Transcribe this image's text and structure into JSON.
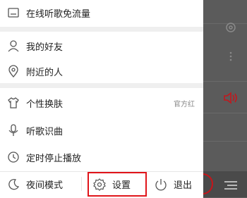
{
  "menu": {
    "free_data": "在线听歌免流量",
    "friends": "我的好友",
    "nearby": "附近的人",
    "skin": "个性换肤",
    "skin_value": "官方红",
    "recognize": "听歌识曲",
    "timer": "定时停止播放"
  },
  "bottom": {
    "night_mode": "夜间模式",
    "settings": "设置",
    "exit": "退出"
  },
  "colors": {
    "highlight": "#e0141a",
    "accent": "#c8141a"
  }
}
